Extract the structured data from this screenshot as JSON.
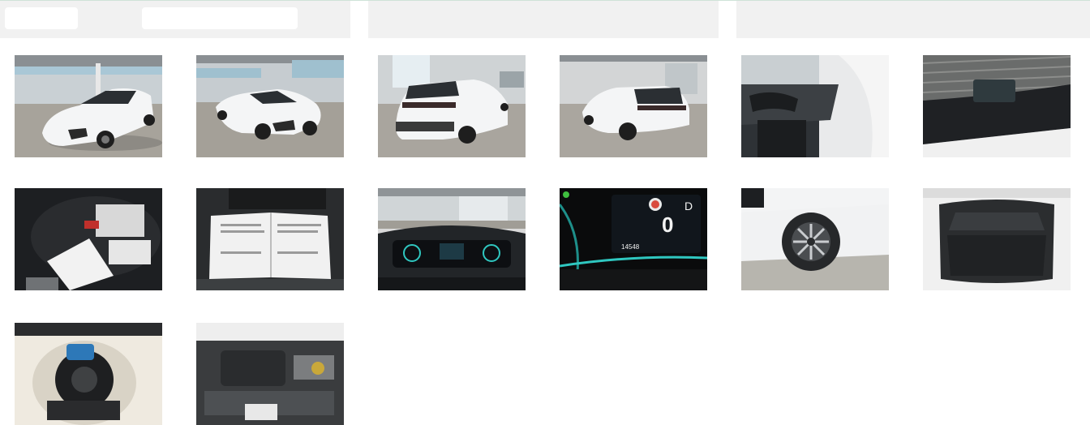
{
  "header": {
    "filter_placeholder": "",
    "search_placeholder": ""
  },
  "gallery": {
    "photos": [
      {
        "icon": "car-front-left-photo"
      },
      {
        "icon": "car-front-right-photo"
      },
      {
        "icon": "car-rear-left-photo"
      },
      {
        "icon": "car-rear-right-photo"
      },
      {
        "icon": "car-interior-photo"
      },
      {
        "icon": "car-roof-photo"
      },
      {
        "icon": "service-documents-photo"
      },
      {
        "icon": "owner-manual-photo"
      },
      {
        "icon": "dashboard-photo"
      },
      {
        "icon": "instrument-cluster-photo",
        "gear": "D",
        "speed": "0",
        "odometer": "14548"
      },
      {
        "icon": "wheel-photo"
      },
      {
        "icon": "trunk-photo"
      },
      {
        "icon": "spare-wheel-well-photo"
      },
      {
        "icon": "engine-bay-photo"
      }
    ]
  },
  "colors": {
    "header_bg": "#f1f1f1",
    "accent_line": "#cfe3d8",
    "car_white": "#f4f5f6",
    "cluster_teal": "#2fc7c0"
  }
}
